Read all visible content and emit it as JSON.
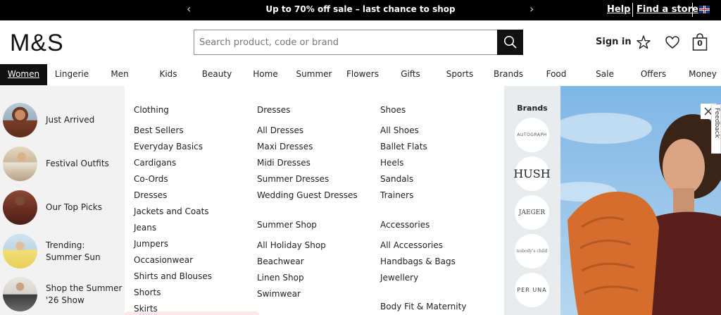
{
  "topbar": {
    "promo": "Up to 70% off sale – last chance to shop",
    "prev_icon": "chevron-left-icon",
    "next_icon": "chevron-right-icon",
    "help": "Help",
    "find_store": "Find a store",
    "flag_icon": "uk-flag-icon"
  },
  "header": {
    "logo": "M&S",
    "search_placeholder": "Search product, code or brand",
    "search_icon": "search-icon",
    "sign_in": "Sign in",
    "loyalty_icon": "star-icon",
    "wishlist_icon": "heart-icon",
    "bag_icon": "shopping-bag-icon",
    "bag_count": "0"
  },
  "nav": {
    "active": "Women",
    "items": [
      "Women",
      "Lingerie",
      "Men",
      "Kids",
      "Beauty",
      "Home",
      "Summer",
      "Flowers",
      "Gifts",
      "Sports",
      "Brands",
      "Food",
      "Sale",
      "Offers",
      "Money"
    ]
  },
  "featured": [
    {
      "label": "Just Arrived"
    },
    {
      "label": "Festival Outfits"
    },
    {
      "label": "Our Top Picks"
    },
    {
      "label": "Trending: Summer Sun"
    },
    {
      "label": "Shop the Summer '26 Show"
    }
  ],
  "columns": {
    "clothing": {
      "heading": "Clothing",
      "links": [
        "Best Sellers",
        "Everyday Basics",
        "Cardigans",
        "Co-Ords",
        "Dresses",
        "Jackets and Coats",
        "Jeans",
        "Jumpers",
        "Occasionwear",
        "Shirts and Blouses",
        "Shorts",
        "Skirts"
      ]
    },
    "dresses": {
      "heading": "Dresses",
      "links": [
        "All Dresses",
        "Maxi Dresses",
        "Midi Dresses",
        "Summer Dresses",
        "Wedding Guest Dresses"
      ]
    },
    "summer_shop": {
      "heading": "Summer Shop",
      "links": [
        "All Holiday Shop",
        "Beachwear",
        "Linen Shop",
        "Swimwear"
      ]
    },
    "shoes": {
      "heading": "Shoes",
      "links": [
        "All Shoes",
        "Ballet Flats",
        "Heels",
        "Sandals",
        "Trainers"
      ]
    },
    "accessories": {
      "heading": "Accessories",
      "links": [
        "All Accessories",
        "Handbags & Bags",
        "Jewellery"
      ]
    },
    "body_fit": {
      "heading": "Body Fit & Maternity"
    }
  },
  "brands": {
    "title": "Brands",
    "logos": [
      "AUTOGRAPH",
      "HUSH",
      "JAEGER",
      "nobody's child",
      "PER UNA"
    ]
  },
  "hero": {
    "close_icon": "close-icon",
    "feedback": "Feedback"
  }
}
